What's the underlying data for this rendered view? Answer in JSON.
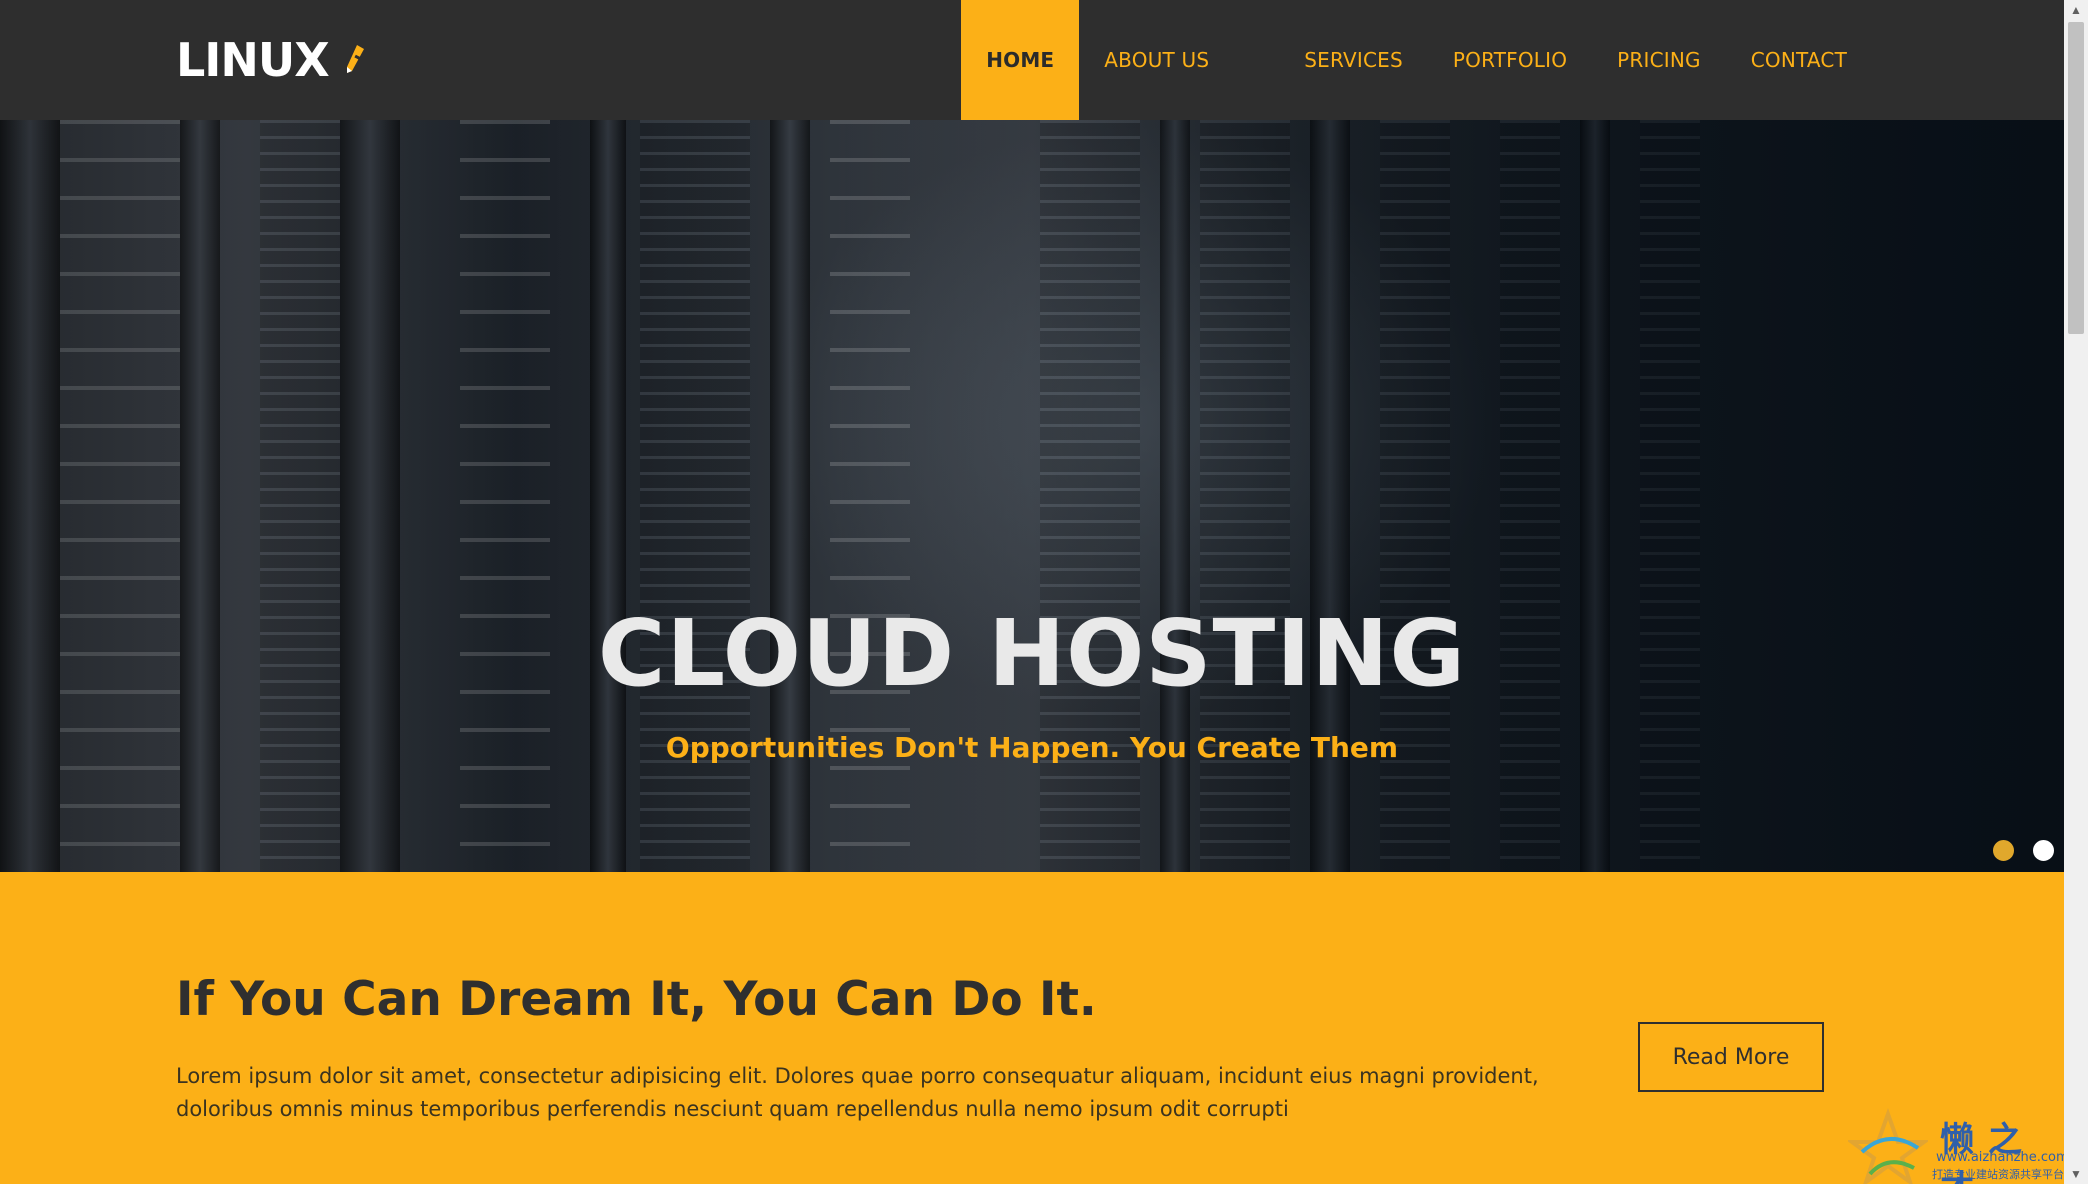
{
  "brand": {
    "name": "LINUX",
    "logo_icon": "pencil-icon",
    "accent": "#fcb017"
  },
  "nav": {
    "items": [
      {
        "label": "HOME",
        "active": true
      },
      {
        "label": "ABOUT US",
        "active": false
      },
      {
        "label": "SERVICES",
        "active": false
      },
      {
        "label": "PORTFOLIO",
        "active": false
      },
      {
        "label": "PRICING",
        "active": false
      },
      {
        "label": "CONTACT",
        "active": false
      }
    ]
  },
  "hero": {
    "title": "CLOUD HOSTING",
    "subtitle": "Opportunities Don't Happen. You Create Them",
    "slides": 2,
    "active_slide": 1
  },
  "callout": {
    "title": "If You Can Dream It, You Can Do It.",
    "text": "Lorem ipsum dolor sit amet, consectetur adipisicing elit. Dolores quae porro consequatur aliquam, incidunt eius magni provident, doloribus omnis minus temporibus perferendis nesciunt quam repellendus nulla nemo ipsum odit corrupti",
    "button_label": "Read More",
    "background": "#fcb017"
  },
  "watermark": {
    "cjk": "懒之才",
    "url": "www.aizhanzhe.com",
    "slogan": "打造专业建站资源共享平台"
  }
}
